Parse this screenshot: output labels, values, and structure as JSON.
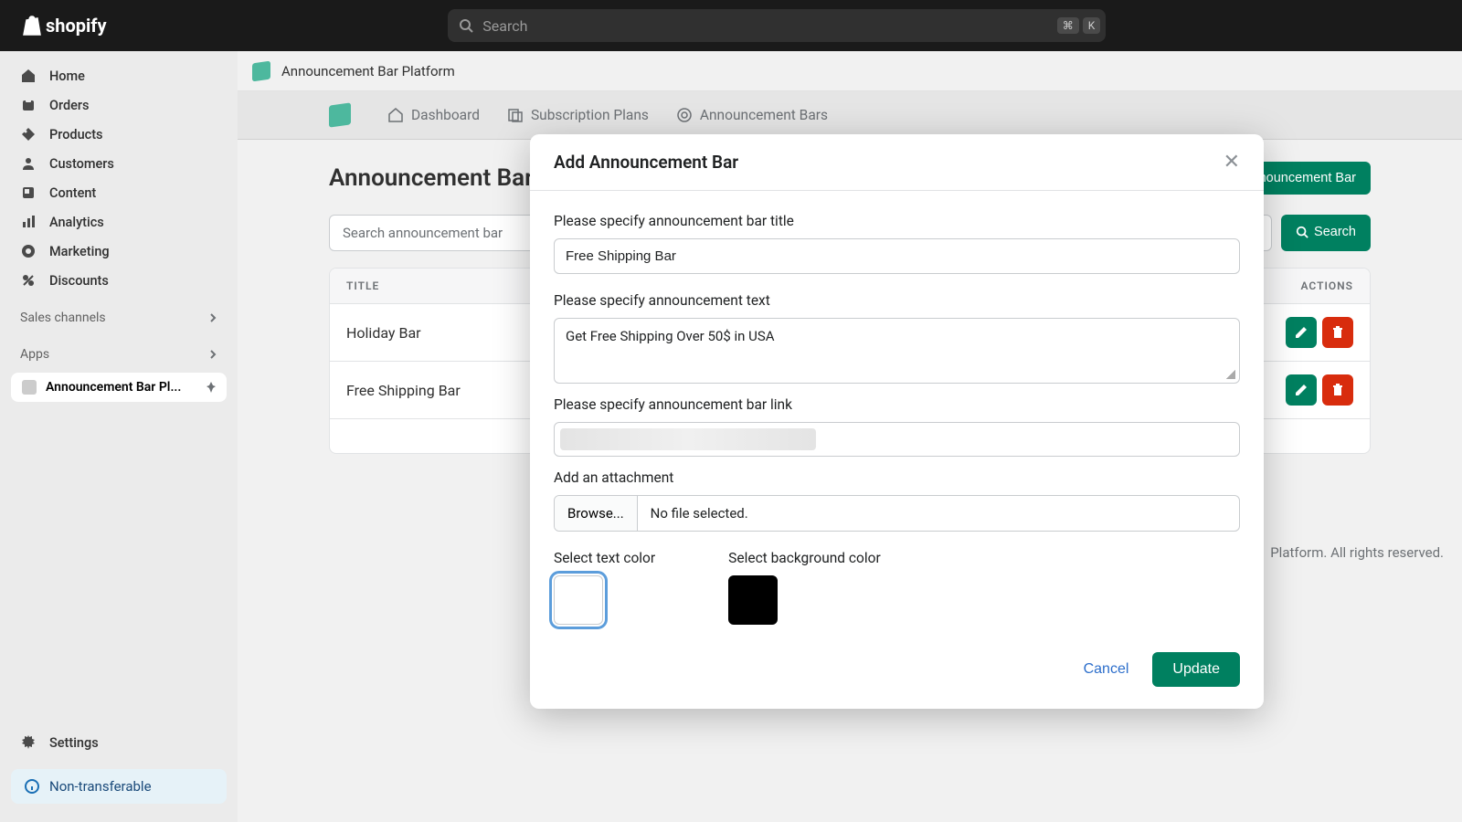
{
  "brand": "shopify",
  "search": {
    "placeholder": "Search",
    "shortcut1": "⌘",
    "shortcut2": "K"
  },
  "sidebar": {
    "items": [
      {
        "label": "Home"
      },
      {
        "label": "Orders"
      },
      {
        "label": "Products"
      },
      {
        "label": "Customers"
      },
      {
        "label": "Content"
      },
      {
        "label": "Analytics"
      },
      {
        "label": "Marketing"
      },
      {
        "label": "Discounts"
      }
    ],
    "sales_channels": "Sales channels",
    "apps": "Apps",
    "app_item": "Announcement Bar Pl...",
    "settings": "Settings",
    "nontransferable": "Non-transferable"
  },
  "page_header": "Announcement Bar Platform",
  "tabs": [
    {
      "label": "Dashboard"
    },
    {
      "label": "Subscription Plans"
    },
    {
      "label": "Announcement Bars"
    }
  ],
  "page": {
    "title": "Announcement Bars",
    "add_button": "Add Announcement Bar",
    "search_placeholder": "Search announcement bar",
    "search_button": "Search",
    "col_title": "TITLE",
    "col_actions": "ACTIONS",
    "rows": [
      {
        "title": "Holiday Bar"
      },
      {
        "title": "Free Shipping Bar"
      }
    ],
    "footer": "Platform. All rights reserved."
  },
  "modal": {
    "title": "Add Announcement Bar",
    "label_title": "Please specify announcement bar title",
    "value_title": "Free Shipping Bar",
    "label_text": "Please specify announcement text",
    "value_text": "Get Free Shipping Over 50$ in USA",
    "label_link": "Please specify announcement bar link",
    "label_attachment": "Add an attachment",
    "browse": "Browse...",
    "no_file": "No file selected.",
    "label_text_color": "Select text color",
    "label_bg_color": "Select background color",
    "text_color": "#ffffff",
    "bg_color": "#000000",
    "cancel": "Cancel",
    "update": "Update"
  }
}
